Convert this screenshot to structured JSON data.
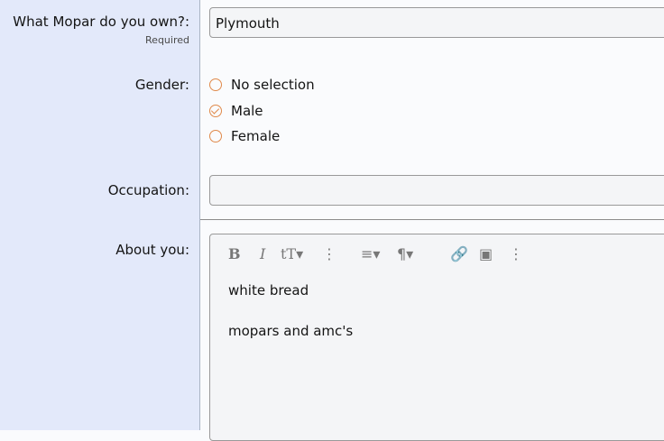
{
  "fields": {
    "mopar": {
      "label": "What Mopar do you own?:",
      "hint": "Required",
      "value": "Plymouth"
    },
    "gender": {
      "label": "Gender:",
      "options": [
        {
          "label": "No selection",
          "checked": false
        },
        {
          "label": "Male",
          "checked": true
        },
        {
          "label": "Female",
          "checked": false
        }
      ]
    },
    "occupation": {
      "label": "Occupation:",
      "value": ""
    },
    "about": {
      "label": "About you:",
      "content": [
        "white bread",
        "mopars and amc's"
      ]
    }
  },
  "toolbar": [
    "bold",
    "italic",
    "text-size",
    "more",
    "align",
    "paragraph",
    "link",
    "image",
    "more"
  ],
  "colors": {
    "label_bg": "#e3e9fa",
    "accent": "#e0894a",
    "field_bg": "#f4f5f7"
  }
}
